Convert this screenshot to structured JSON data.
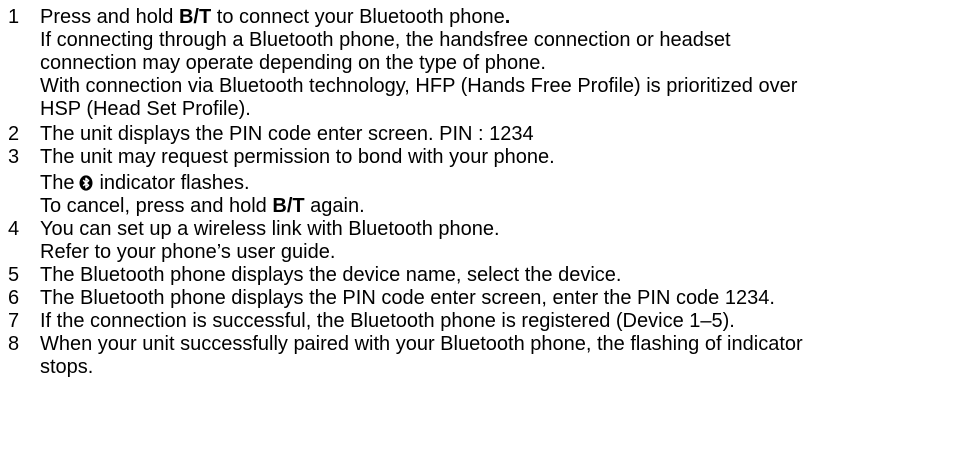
{
  "steps": [
    {
      "num": "1",
      "main_pre": "Press and hold ",
      "main_bold": "B/T",
      "main_post": " to connect your Bluetooth phone",
      "main_end": ".",
      "para1_line1": "If connecting through a Bluetooth phone, the handsfree connection or headset",
      "para1_line2": "connection may operate depending on the type of phone.",
      "para2_line1": "With connection via Bluetooth technology, HFP (Hands Free Profile) is prioritized over",
      "para2_line2": "HSP (Head Set Profile)."
    },
    {
      "num": "2",
      "text": "The unit displays the PIN code enter screen. PIN : 1234"
    },
    {
      "num": "3",
      "text": "The unit may request permission to bond with your phone.",
      "indicator_pre": "The",
      "indicator_post": "indicator flashes.",
      "cancel_pre": "To cancel, press and hold ",
      "cancel_bold": "B/T",
      "cancel_post": " again."
    },
    {
      "num": "4",
      "line1": "You can set up a wireless link with Bluetooth phone.",
      "line2": "Refer to your phone’s user guide."
    },
    {
      "num": "5",
      "text": "The Bluetooth phone displays the device name, select the device."
    },
    {
      "num": "6",
      "text": "The Bluetooth phone displays the PIN code enter screen, enter the PIN code 1234."
    },
    {
      "num": "7",
      "text": "If the connection is successful, the Bluetooth phone is registered (Device 1–5)."
    },
    {
      "num": "8",
      "line1": "When your unit successfully paired with your Bluetooth phone, the flashing of indicator",
      "line2": "stops."
    }
  ],
  "icons": {
    "indicator": "bluetooth-icon"
  }
}
